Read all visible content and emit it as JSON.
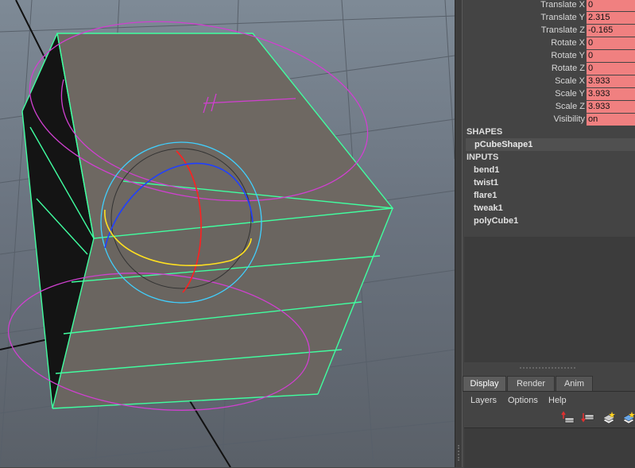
{
  "attributes": [
    {
      "label": "Translate X",
      "value": "0"
    },
    {
      "label": "Translate Y",
      "value": "2.315"
    },
    {
      "label": "Translate Z",
      "value": "-0.165"
    },
    {
      "label": "Rotate X",
      "value": "0"
    },
    {
      "label": "Rotate Y",
      "value": "0"
    },
    {
      "label": "Rotate Z",
      "value": "0"
    },
    {
      "label": "Scale X",
      "value": "3.933"
    },
    {
      "label": "Scale Y",
      "value": "3.933"
    },
    {
      "label": "Scale Z",
      "value": "3.933"
    },
    {
      "label": "Visibility",
      "value": "on"
    }
  ],
  "shapes": {
    "header": "SHAPES",
    "items": [
      "pCubeShape1"
    ]
  },
  "inputs": {
    "header": "INPUTS",
    "items": [
      "bend1",
      "twist1",
      "flare1",
      "tweak1",
      "polyCube1"
    ]
  },
  "layer_editor": {
    "tabs": [
      "Display",
      "Render",
      "Anim"
    ],
    "active_tab": "Display",
    "menus": [
      "Layers",
      "Options",
      "Help"
    ],
    "tool_icons": [
      "move-layer-up-icon",
      "move-layer-down-icon",
      "new-layer-icon",
      "new-layer-from-selection-icon"
    ]
  },
  "colors": {
    "channel_value_bg": "#f08080",
    "wireframe_highlight": "#40ffa0",
    "manipulator_magenta": "#d040d0",
    "manipulator_cyan": "#40d0ff",
    "axis_red": "#ff2020",
    "axis_blue": "#2040ff",
    "axis_yellow": "#ffe020"
  }
}
